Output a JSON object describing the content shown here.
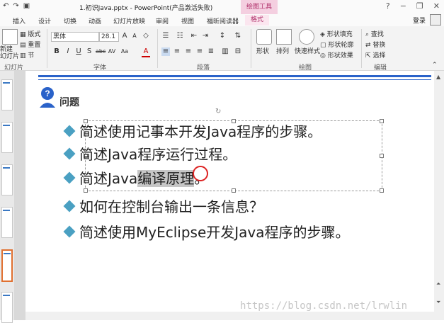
{
  "window": {
    "title": "1.初识Java.pptx - PowerPoint(产品激活失败)",
    "contextual_tools_label": "绘图工具",
    "login_label": "登录",
    "controls": [
      "?",
      "−",
      "❐",
      "✕"
    ]
  },
  "tabs": [
    "插入",
    "设计",
    "切换",
    "动画",
    "幻灯片放映",
    "审阅",
    "视图",
    "福昕阅读器",
    "格式"
  ],
  "ribbon": {
    "slides": {
      "new_slide": "新建\n幻灯片",
      "layout": "版式",
      "reset": "重置",
      "section": "节",
      "label": "幻灯片"
    },
    "font": {
      "name": "黑体",
      "size": "28.1",
      "label": "字体"
    },
    "paragraph": {
      "label": "段落"
    },
    "drawing": {
      "shapes": "形状",
      "arrange": "排列",
      "quick_styles": "快速样式",
      "shape_fill": "形状填充",
      "shape_outline": "形状轮廓",
      "shape_effects": "形状效果",
      "label": "绘图"
    },
    "editing": {
      "find": "查找",
      "replace": "替换",
      "select": "选择",
      "label": "编辑"
    }
  },
  "slide": {
    "heading": "问题",
    "bullets": [
      {
        "text": "简述使用记事本开发Java程序的步骤。"
      },
      {
        "text": "简述Java程序运行过程。"
      },
      {
        "pre": "简述Java",
        "hl": "编译原理",
        "post": "。"
      },
      {
        "text": "如何在控制台输出一条信息？"
      },
      {
        "text": "简述使用MyEclipse开发Java程序的步骤。"
      }
    ]
  },
  "watermark": "https://blog.csdn.net/lrwlin",
  "colors": {
    "accent": "#2a62c9",
    "bullet": "#4aa0c2",
    "context_tab": "#b0306a"
  }
}
